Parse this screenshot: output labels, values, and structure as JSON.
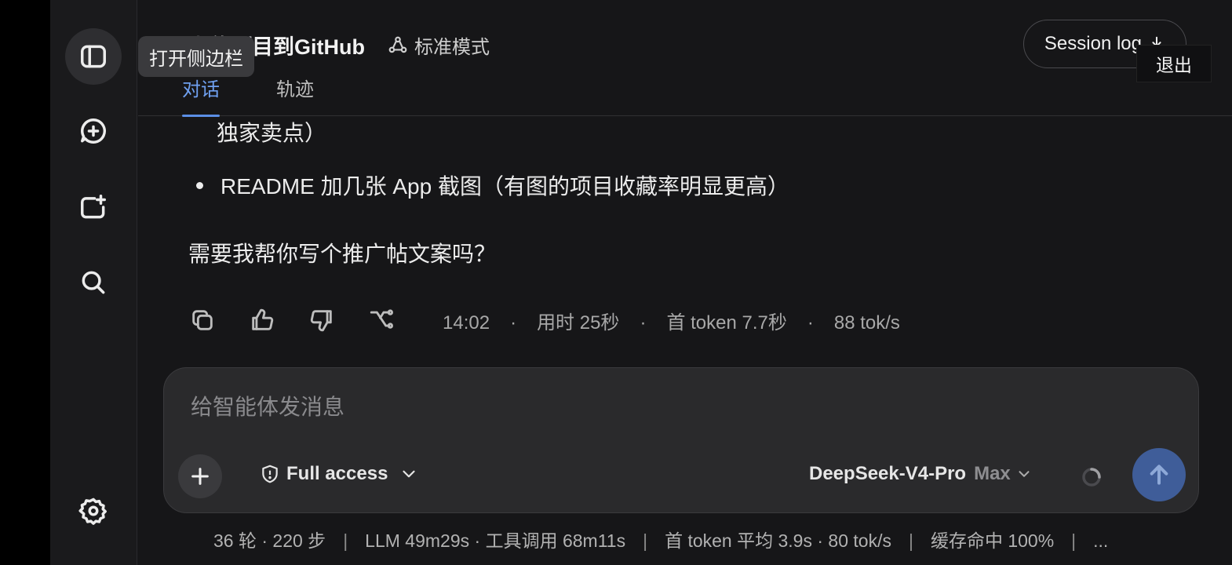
{
  "sidebar": {
    "toggle_icon": "sidebar-panel-icon",
    "new_chat_icon": "chat-plus-icon",
    "new_project_icon": "folder-plus-icon",
    "search_icon": "search-icon",
    "settings_icon": "gear-icon"
  },
  "tooltip": {
    "sidebar_open": "打开侧边栏"
  },
  "header": {
    "title": "上传项目到GitHub",
    "mode_label": "标准模式",
    "tabs": [
      {
        "label": "对话",
        "active": true
      },
      {
        "label": "轨迹",
        "active": false
      }
    ],
    "session_log_label": "Session log",
    "exit_tooltip": "退出"
  },
  "message": {
    "continued_line": "独家卖点）",
    "bullet": "README 加几张 App 截图（有图的项目收藏率明显更高）",
    "closing": "需要我帮你写个推广帖文案吗？"
  },
  "message_meta": {
    "time": "14:02",
    "duration": "用时 25秒",
    "first_token": "首 token 7.7秒",
    "speed": "88 tok/s",
    "separator": "·"
  },
  "composer": {
    "placeholder": "给智能体发消息",
    "value": "",
    "access_label": "Full access",
    "model_name": "DeepSeek-V4-Pro",
    "model_level": "Max"
  },
  "footer": {
    "rounds": "36 轮 · 220 步",
    "llm": "LLM 49m29s · 工具调用 68m11s",
    "first_token": "首 token 平均 3.9s · 80 tok/s",
    "cache": "缓存命中 100%",
    "more": "...",
    "pipe": "|"
  },
  "colors": {
    "accent": "#5b8fe6",
    "send_button": "#3f5d99",
    "background": "#161618"
  }
}
